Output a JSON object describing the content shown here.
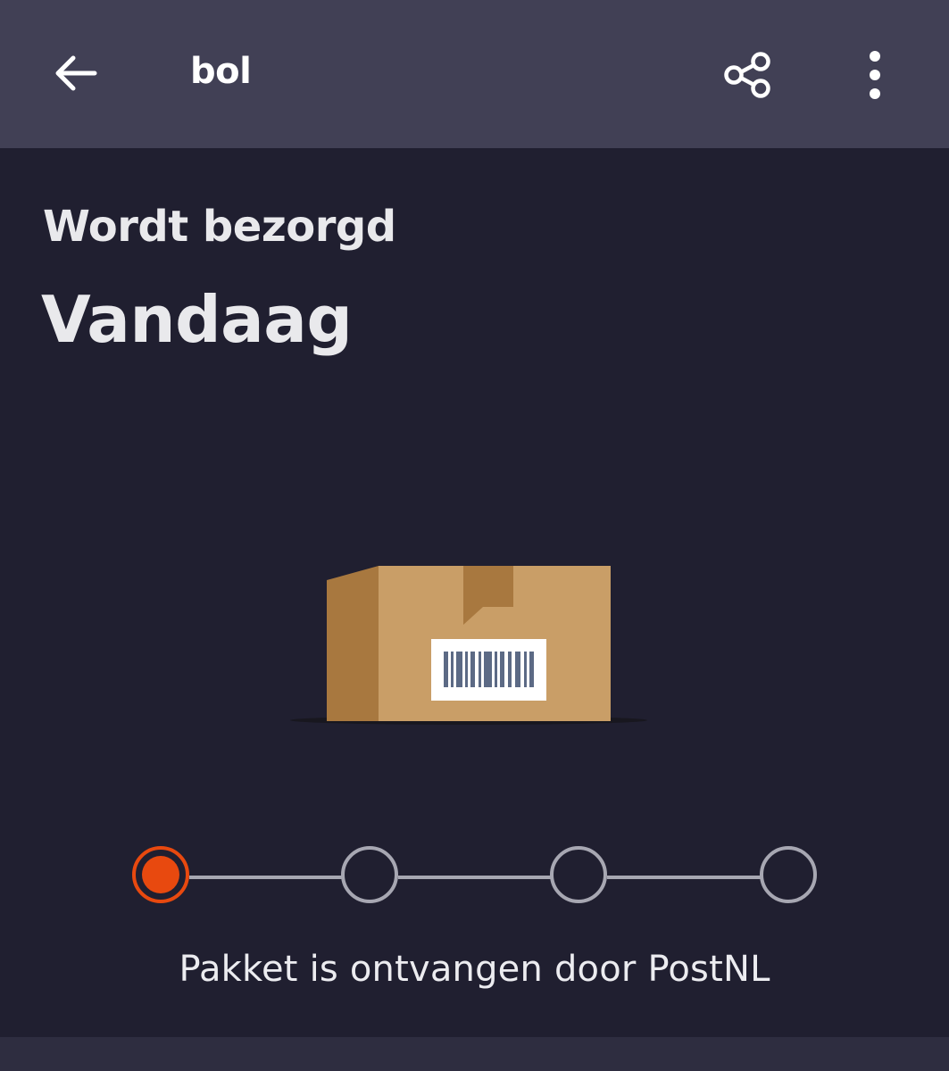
{
  "header": {
    "title": "bol",
    "back_icon": "arrow-left-icon",
    "share_icon": "share-icon",
    "more_icon": "more-vertical-icon"
  },
  "delivery": {
    "status_label": "Wordt bezorgd",
    "day": "Vandaag"
  },
  "illustration": {
    "icon": "package-box-icon"
  },
  "progress": {
    "steps_total": 4,
    "current_step": 1,
    "message": "Pakket is ontvangen door PostNL"
  },
  "colors": {
    "header_bg": "#414055",
    "page_bg": "#201f30",
    "accent": "#e8490f",
    "inactive": "#a7a7b2",
    "box": "#c99e67"
  }
}
